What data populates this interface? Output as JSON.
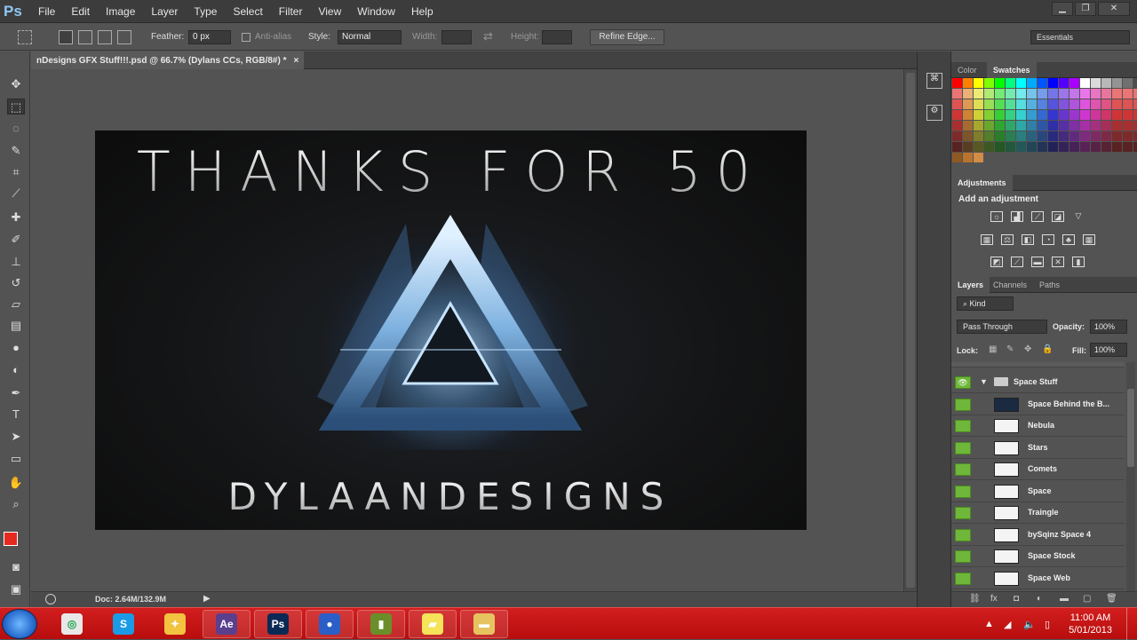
{
  "app": {
    "logo": "Ps",
    "minimize": "▁",
    "maximize": "❐",
    "close": "✕"
  },
  "menu": [
    "File",
    "Edit",
    "Image",
    "Layer",
    "Type",
    "Select",
    "Filter",
    "View",
    "Window",
    "Help"
  ],
  "options": {
    "feather_label": "Feather:",
    "feather_value": "0 px",
    "antialias_label": "Anti-alias",
    "style_label": "Style:",
    "style_value": "Normal",
    "width_label": "Width:",
    "height_label": "Height:",
    "refine_edge": "Refine Edge...",
    "workspace": "Essentials"
  },
  "document": {
    "tab_title": "nDesigns GFX Stuff!!!.psd @ 66.7% (Dylans CCs, RGB/8#) *",
    "tab_close": "×",
    "doc_size": "Doc: 2.64M/132.9M",
    "art_title": "THANKS FOR 50",
    "art_subtitle": "DYLAANDESIGNS"
  },
  "panels": {
    "color_tab": "Color",
    "swatches_tab": "Swatches",
    "adjustments_tab": "Adjustments",
    "add_adjustment": "Add an adjustment",
    "layers_tab": "Layers",
    "channels_tab": "Channels",
    "paths_tab": "Paths",
    "kind": "Kind",
    "blend_mode": "Pass Through",
    "opacity_label": "Opacity:",
    "opacity_value": "100%",
    "lock_label": "Lock:",
    "fill_label": "Fill:",
    "fill_value": "100%"
  },
  "layers": [
    {
      "name": "Space Stuff",
      "group": true
    },
    {
      "name": "Space Behind the B..."
    },
    {
      "name": "Nebula"
    },
    {
      "name": "Stars"
    },
    {
      "name": "Comets"
    },
    {
      "name": "Space"
    },
    {
      "name": "Traingle"
    },
    {
      "name": "bySqinz Space 4"
    },
    {
      "name": "Space Stock"
    },
    {
      "name": "Space Web"
    }
  ],
  "colors": {
    "accent": "#6fb73a",
    "foreground": "#e52a1f",
    "background": "#ffffff",
    "taskbar": "#c41414"
  },
  "taskbar": {
    "apps": [
      {
        "label": "◎",
        "icon": "chrome-icon"
      },
      {
        "label": "S",
        "icon": "skype-icon"
      },
      {
        "label": "✦",
        "icon": "itunes-icon"
      },
      {
        "label": "Ae",
        "icon": "after-effects-icon"
      },
      {
        "label": "Ps",
        "icon": "photoshop-icon"
      },
      {
        "label": "●",
        "icon": "browser-icon"
      },
      {
        "label": "▮",
        "icon": "winrar-icon"
      },
      {
        "label": "▰",
        "icon": "sticky-notes-icon"
      },
      {
        "label": "▬",
        "icon": "explorer-icon"
      }
    ],
    "time": "11:00 AM",
    "date": "5/01/2013"
  }
}
